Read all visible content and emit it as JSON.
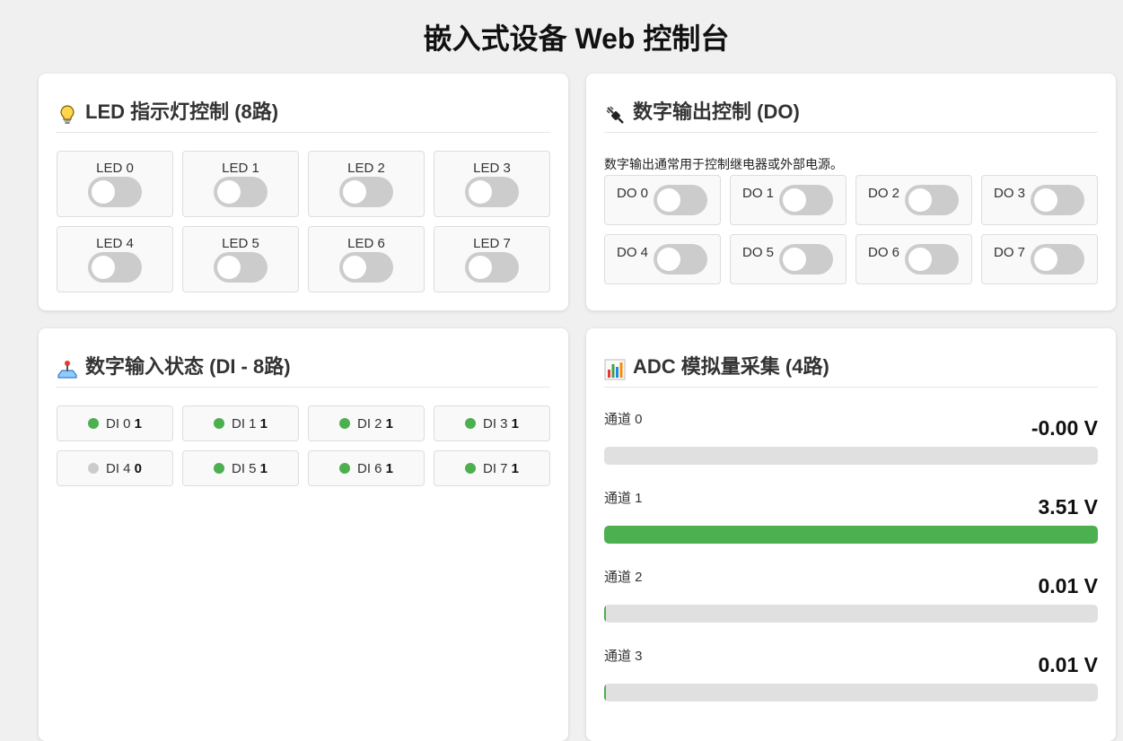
{
  "page": {
    "title": "嵌入式设备 Web 控制台"
  },
  "colors": {
    "on": "#4caf50",
    "off": "#cccccc",
    "track": "#e0e0e0"
  },
  "led": {
    "title": "LED 指示灯控制 (8路)",
    "icon": "lightbulb-icon",
    "items": [
      {
        "label": "LED 0",
        "on": false
      },
      {
        "label": "LED 1",
        "on": false
      },
      {
        "label": "LED 2",
        "on": false
      },
      {
        "label": "LED 3",
        "on": false
      },
      {
        "label": "LED 4",
        "on": false
      },
      {
        "label": "LED 5",
        "on": false
      },
      {
        "label": "LED 6",
        "on": false
      },
      {
        "label": "LED 7",
        "on": false
      }
    ]
  },
  "do": {
    "title": "数字输出控制 (DO)",
    "icon": "plug-icon",
    "note": "数字输出通常用于控制继电器或外部电源。",
    "items": [
      {
        "label": "DO 0",
        "on": false
      },
      {
        "label": "DO 1",
        "on": false
      },
      {
        "label": "DO 2",
        "on": false
      },
      {
        "label": "DO 3",
        "on": false
      },
      {
        "label": "DO 4",
        "on": false
      },
      {
        "label": "DO 5",
        "on": false
      },
      {
        "label": "DO 6",
        "on": false
      },
      {
        "label": "DO 7",
        "on": false
      }
    ]
  },
  "di": {
    "title": "数字输入状态 (DI - 8路)",
    "icon": "joystick-icon",
    "items": [
      {
        "label": "DI 0",
        "value": "1"
      },
      {
        "label": "DI 1",
        "value": "1"
      },
      {
        "label": "DI 2",
        "value": "1"
      },
      {
        "label": "DI 3",
        "value": "1"
      },
      {
        "label": "DI 4",
        "value": "0"
      },
      {
        "label": "DI 5",
        "value": "1"
      },
      {
        "label": "DI 6",
        "value": "1"
      },
      {
        "label": "DI 7",
        "value": "1"
      }
    ]
  },
  "adc": {
    "title": "ADC 模拟量采集 (4路)",
    "icon": "bar-chart-icon",
    "channels": [
      {
        "name": "通道 0",
        "value": "-0.00 V",
        "level": 0
      },
      {
        "name": "通道 1",
        "value": "3.51 V",
        "level": 1.0
      },
      {
        "name": "通道 2",
        "value": "0.01 V",
        "level": 0.003
      },
      {
        "name": "通道 3",
        "value": "0.01 V",
        "level": 0.003
      }
    ]
  }
}
